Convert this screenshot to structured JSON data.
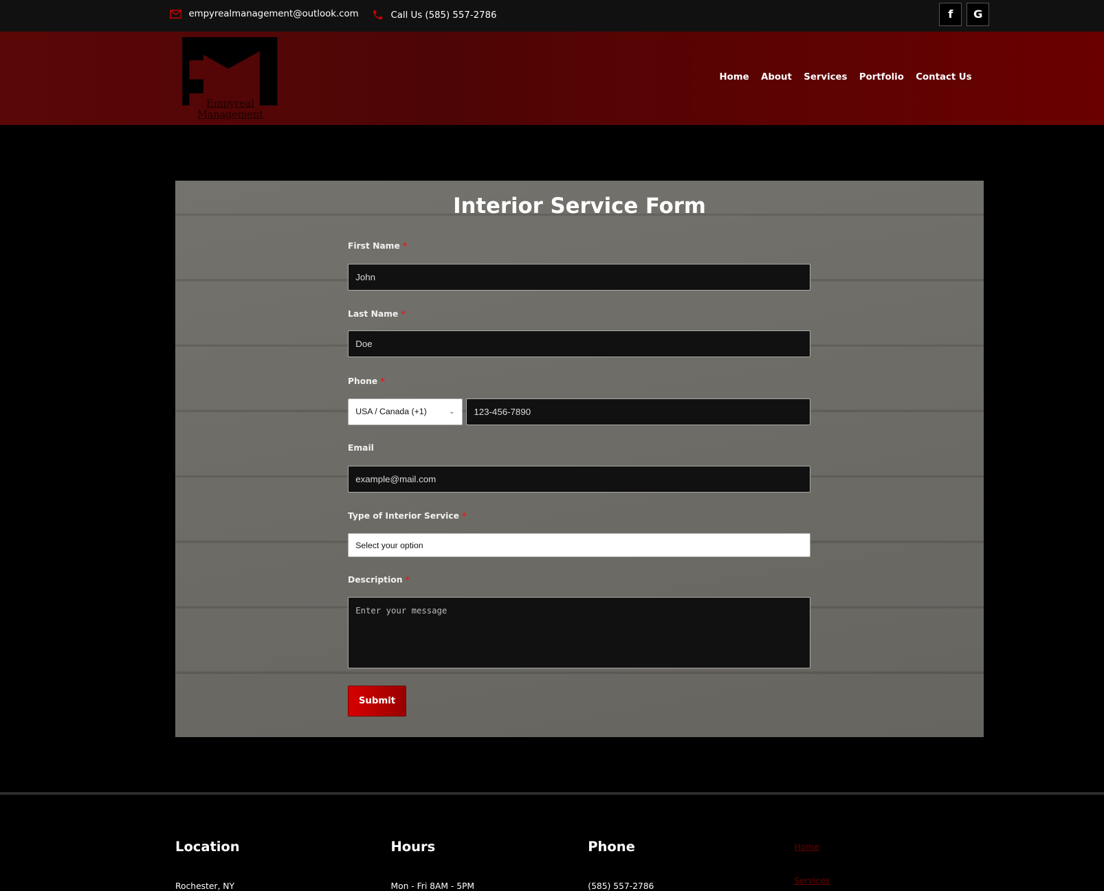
{
  "topbar": {
    "email": "empyrealmanagement@outlook.com",
    "phone": "Call Us (585) 557-2786",
    "social": [
      {
        "icon": "facebook-icon",
        "glyph": "f"
      },
      {
        "icon": "google-icon",
        "glyph": "G"
      }
    ]
  },
  "header": {
    "logo_letters": "EM",
    "logo_text": "Empyreal Management",
    "nav": [
      "Home",
      "About",
      "Services",
      "Portfolio",
      "Contact Us"
    ]
  },
  "form": {
    "title": "Interior Service Form",
    "first_name": {
      "label": "First Name",
      "required": "*",
      "value": "John"
    },
    "last_name": {
      "label": "Last Name",
      "required": "*",
      "value": "Doe"
    },
    "phone": {
      "label": "Phone",
      "required": "*",
      "country": "USA / Canada (+1)",
      "value": "123-456-7890"
    },
    "email": {
      "label": "Email",
      "value": "example@mail.com"
    },
    "service": {
      "label": "Type of Interior Service",
      "required": "*",
      "value": "Select your option"
    },
    "description": {
      "label": "Description",
      "required": "*",
      "placeholder": "Enter your message"
    },
    "submit": "Submit"
  },
  "footer": {
    "location": {
      "title": "Location",
      "text": "Rochester, NY"
    },
    "hours": {
      "title": "Hours",
      "text": "Mon - Fri 8AM - 5PM"
    },
    "phone": {
      "title": "Phone",
      "text": "(585) 557-2786"
    },
    "links": [
      "Home",
      "Services"
    ]
  },
  "colors": {
    "accent": "#d60000",
    "header": "#5a0707",
    "topbar": "#111111"
  }
}
